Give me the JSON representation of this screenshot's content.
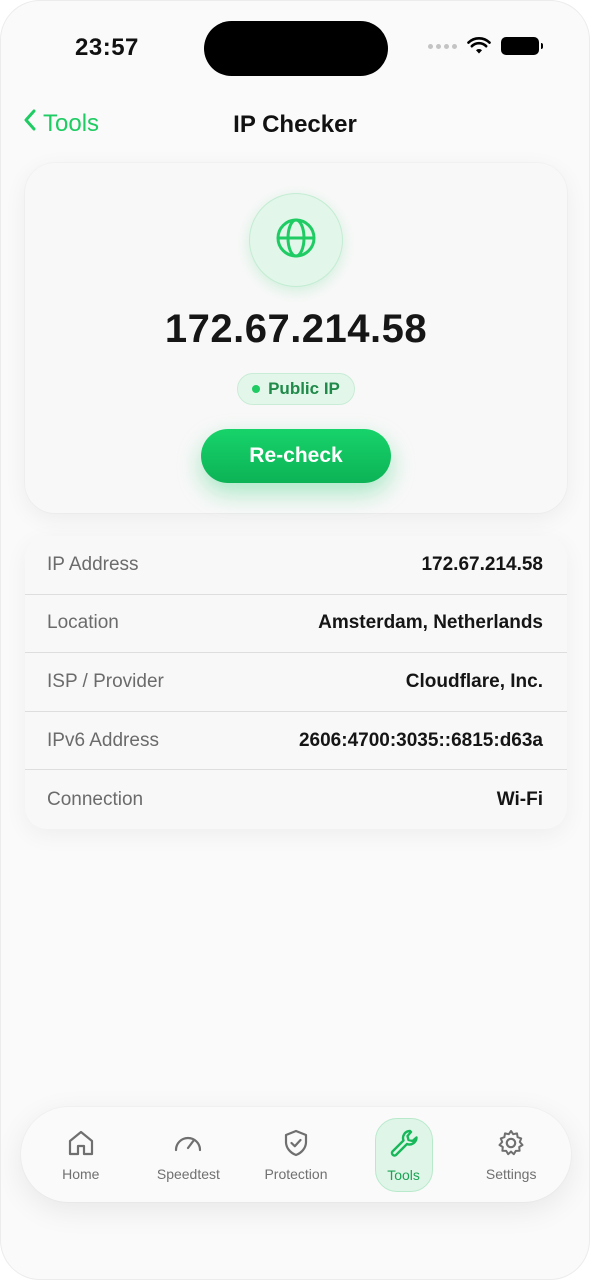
{
  "status_bar": {
    "time": "23:57"
  },
  "nav": {
    "back_label": "Tools",
    "title": "IP Checker"
  },
  "hero": {
    "ip": "172.67.214.58",
    "badge": "Public IP",
    "button": "Re-check"
  },
  "info": {
    "rows": [
      {
        "label": "IP Address",
        "value": "172.67.214.58"
      },
      {
        "label": "Location",
        "value": "Amsterdam, Netherlands"
      },
      {
        "label": "ISP / Provider",
        "value": "Cloudflare, Inc."
      },
      {
        "label": "IPv6 Address",
        "value": "2606:4700:3035::6815:d63a"
      },
      {
        "label": "Connection",
        "value": "Wi-Fi"
      }
    ]
  },
  "tabs": [
    {
      "label": "Home",
      "icon": "home-icon"
    },
    {
      "label": "Speedtest",
      "icon": "speedometer-icon"
    },
    {
      "label": "Protection",
      "icon": "shield-check-icon"
    },
    {
      "label": "Tools",
      "icon": "wrench-icon",
      "active": true
    },
    {
      "label": "Settings",
      "icon": "gear-icon"
    }
  ],
  "colors": {
    "accent": "#1fcb63",
    "accent_dark": "#1aa354"
  }
}
